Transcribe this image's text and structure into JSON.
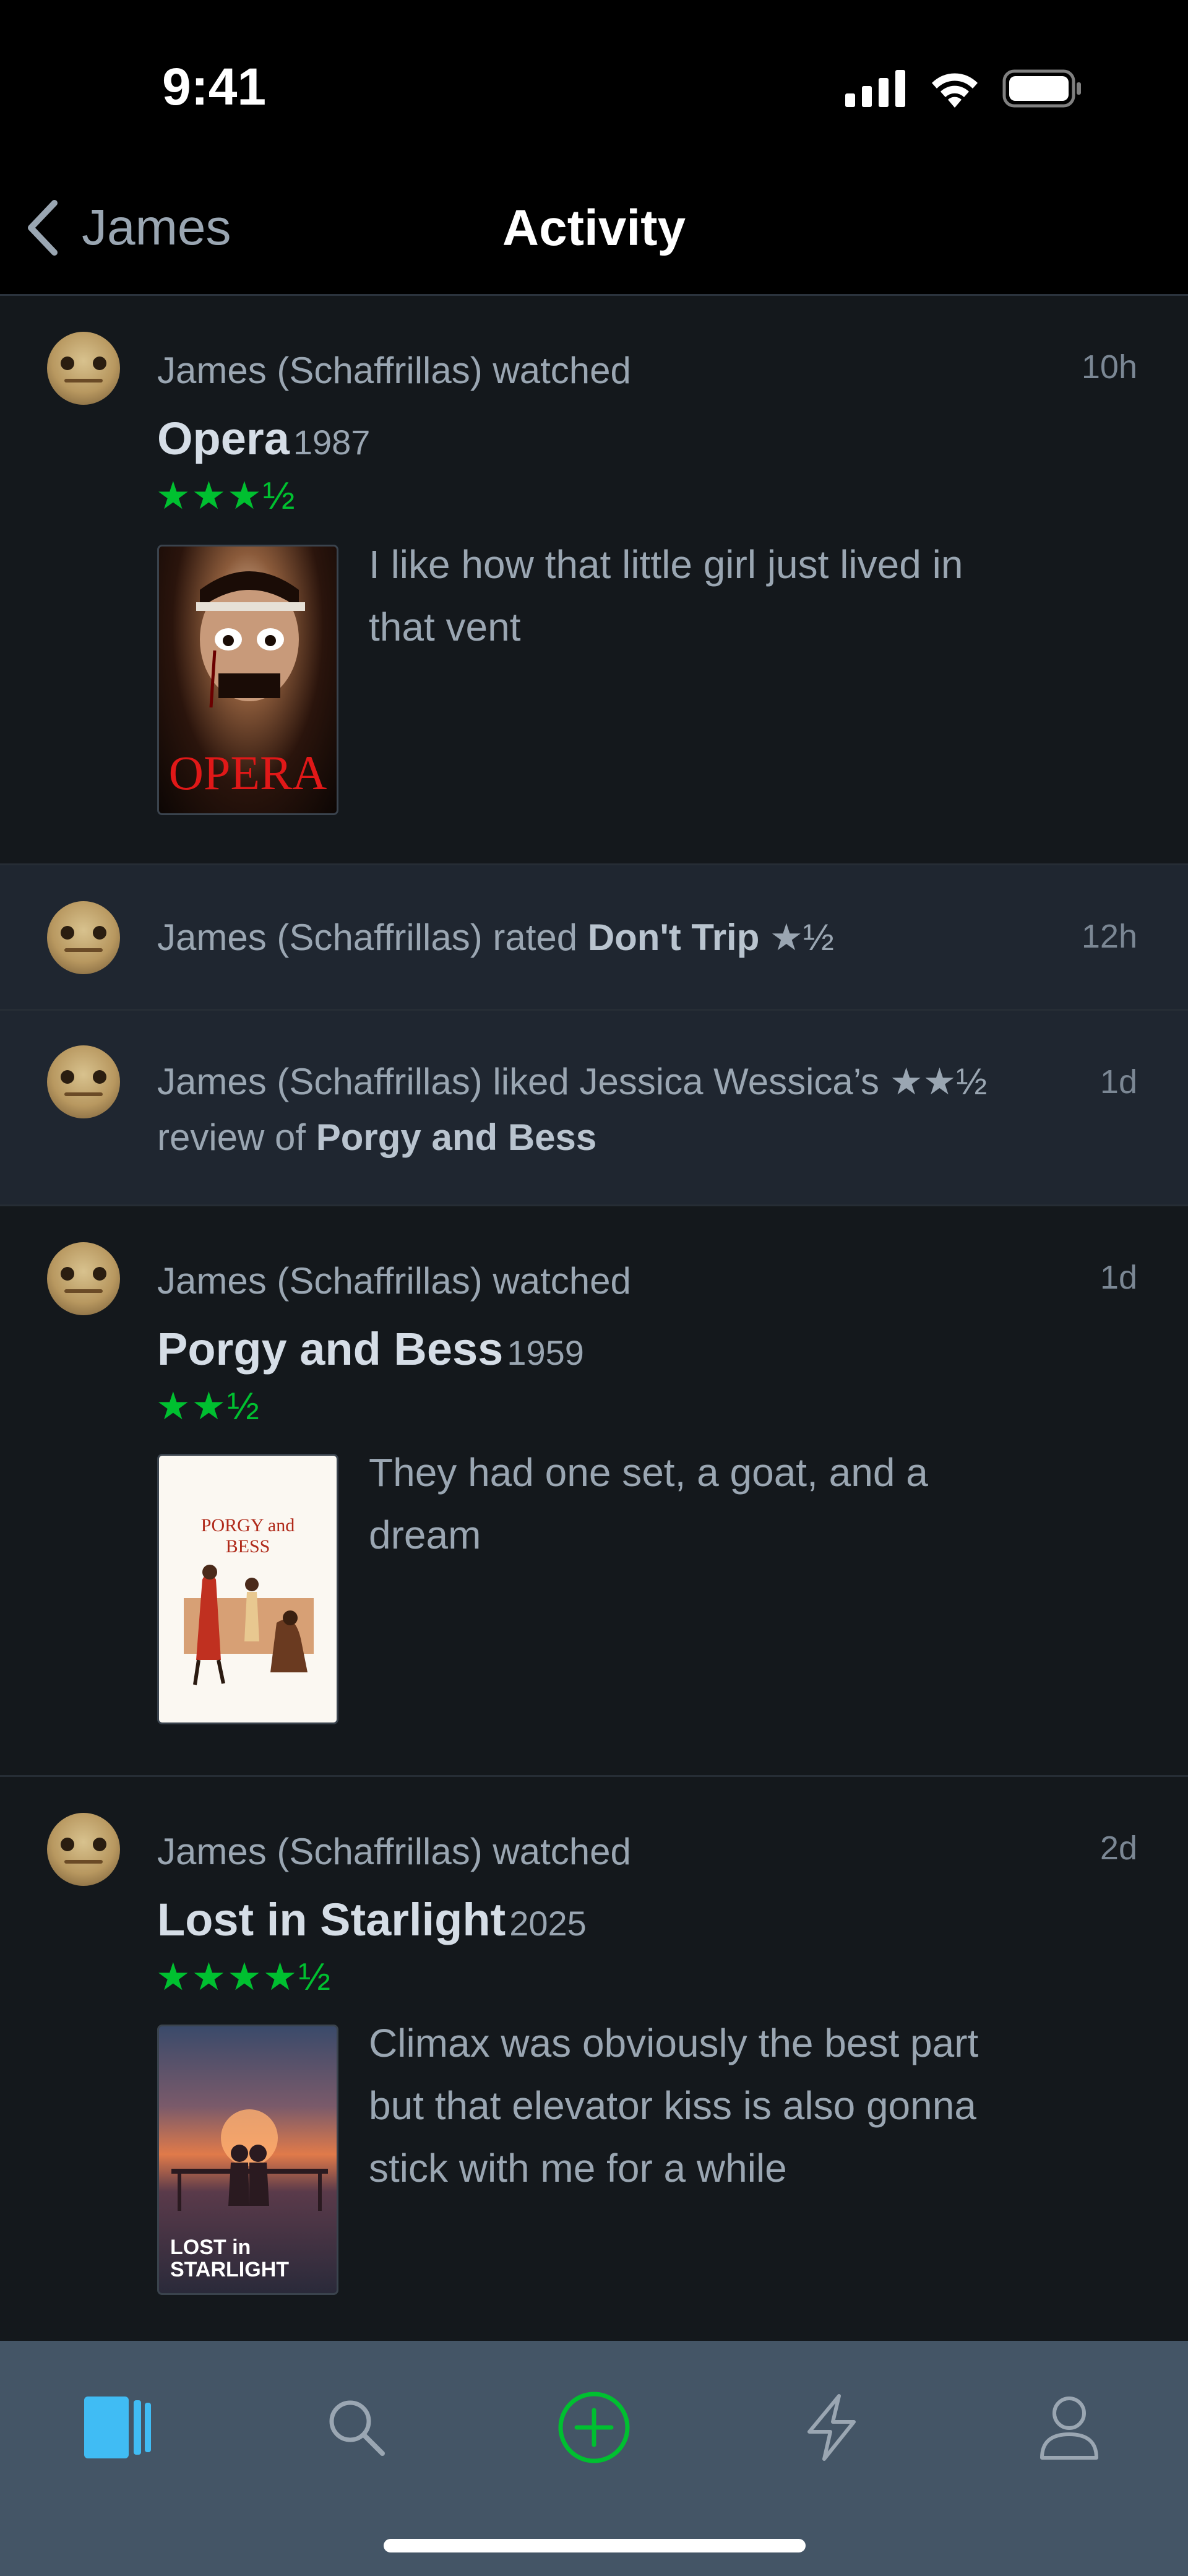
{
  "status": {
    "time": "9:41"
  },
  "nav": {
    "back_label": "James",
    "title": "Activity"
  },
  "entries": [
    {
      "type": "watched",
      "action": "James (Schaffrillas) watched",
      "time": "10h",
      "film": "Opera",
      "year": "1987",
      "stars": "★★★½",
      "poster_text": "OPERA",
      "review": "I like how that little girl just lived in that vent"
    },
    {
      "type": "rated",
      "prefix": "James (Schaffrillas) rated ",
      "film": "Don't Trip",
      "stars": "★½",
      "time": "12h"
    },
    {
      "type": "liked",
      "prefix": "James (Schaffrillas) liked Jessica Wessica’s ",
      "stars": "★★½",
      "suffix": "review of ",
      "film": "Porgy and Bess",
      "time": "1d"
    },
    {
      "type": "watched",
      "action": "James (Schaffrillas) watched",
      "time": "1d",
      "film": "Porgy and Bess",
      "year": "1959",
      "stars": "★★½",
      "poster_text": "PORGY and BESS",
      "review": "They had one set, a goat, and a dream"
    },
    {
      "type": "watched",
      "action": "James (Schaffrillas) watched",
      "time": "2d",
      "film": "Lost in Starlight",
      "year": "2025",
      "stars": "★★★★½",
      "poster_text": "LOST in STARLIGHT",
      "review": "Climax was obviously the best part but that elevator kiss is also gonna stick with me for a while"
    }
  ],
  "tabs": [
    "diary-icon",
    "search-icon",
    "add-icon",
    "activity-icon",
    "profile-icon"
  ],
  "colors": {
    "accent_green": "#00c030",
    "active_tab": "#40bcf4",
    "tabbar_bg": "#445566"
  }
}
